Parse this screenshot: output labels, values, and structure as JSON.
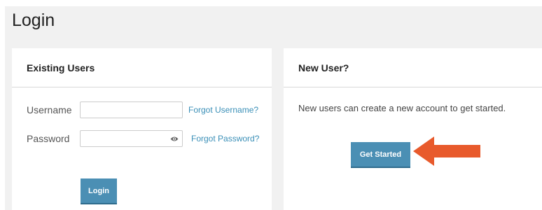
{
  "page": {
    "title": "Login"
  },
  "existing_users": {
    "heading": "Existing Users",
    "username_label": "Username",
    "username_value": "",
    "forgot_username": "Forgot Username?",
    "password_label": "Password",
    "password_value": "",
    "forgot_password": "Forgot Password?",
    "login_button": "Login"
  },
  "new_user": {
    "heading": "New User?",
    "description": "New users can create a new account to get started.",
    "get_started_button": "Get Started"
  },
  "icons": {
    "password_toggle": "eye-icon",
    "annotation": "arrow-left-icon"
  },
  "colors": {
    "accent": "#4b8fb4",
    "link": "#3a8fb7",
    "annotation_arrow": "#e85a2c",
    "page_background": "#f1f1f1"
  }
}
